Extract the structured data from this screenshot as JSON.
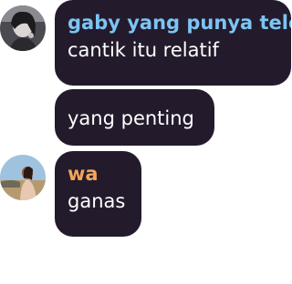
{
  "messages": [
    {
      "sender": "gaby yang punya tele",
      "sender_color": "#7cc4f3",
      "avatar": "profile-photo-gaby",
      "lines": [
        "cantik itu relatif",
        "yang penting"
      ]
    },
    {
      "sender": "wa",
      "sender_color": "#f0a55a",
      "avatar": "profile-photo-wa",
      "lines": [
        "ganas"
      ]
    }
  ],
  "colors": {
    "bubble_background": "#231b2c",
    "message_text": "#ffffff",
    "page_background": "#ffffff"
  }
}
